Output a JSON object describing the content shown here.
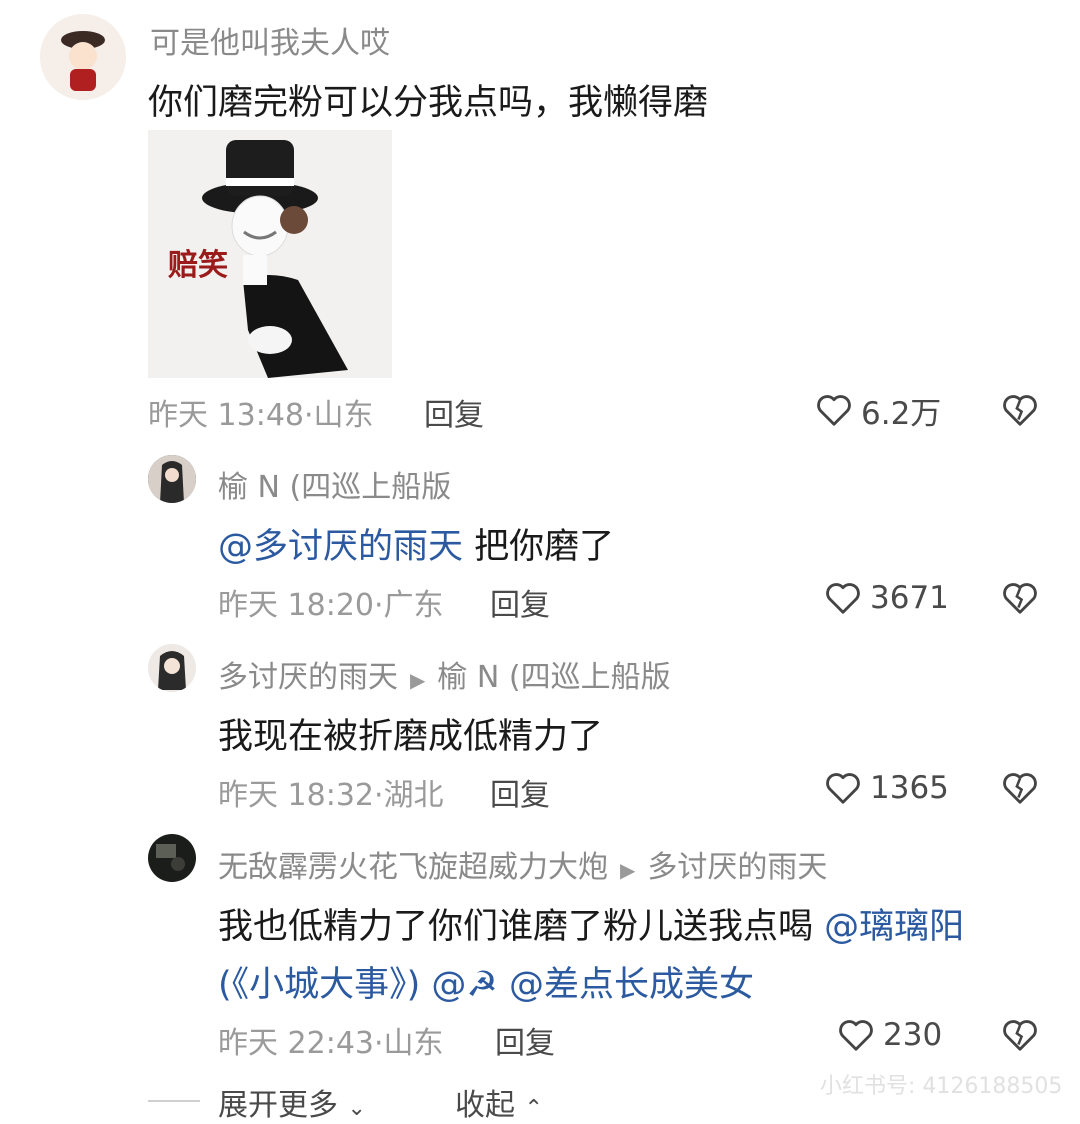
{
  "comments": [
    {
      "username": "可是他叫我夫人哎",
      "text": "你们磨完粉可以分我点吗，我懒得磨",
      "sticker_text": "赔笑",
      "time": "昨天 13:48",
      "location": "山东",
      "reply_label": "回复",
      "likes": "6.2万"
    }
  ],
  "replies": [
    {
      "username": "榆 N (四巡上船版",
      "mention": "@多讨厌的雨天",
      "text": " 把你磨了",
      "time": "昨天 18:20",
      "location": "广东",
      "reply_label": "回复",
      "likes": "3671"
    },
    {
      "username": "多讨厌的雨天",
      "reply_to": "榆 N (四巡上船版",
      "text": "我现在被折磨成低精力了",
      "time": "昨天 18:32",
      "location": "湖北",
      "reply_label": "回复",
      "likes": "1365"
    },
    {
      "username": "无敌霹雳火花飞旋超威力大炮",
      "reply_to": "多讨厌的雨天",
      "text_line1": "我也低精力了你们谁磨了粉儿送我点喝 ",
      "mention1": "@璃璃阳",
      "mention2_line2": "(《小城大事》) @☭ @差点长成美女",
      "time": "昨天 22:43",
      "location": "山东",
      "reply_label": "回复",
      "likes": "230"
    }
  ],
  "footer": {
    "expand_more": "展开更多",
    "collapse": "收起",
    "watermark": "小红书号: 4126188505"
  },
  "colors": {
    "mention": "#2c5aa0",
    "meta": "#9a9a9a",
    "name": "#8a8a8a"
  },
  "icons": [
    "heart-icon",
    "broken-heart-icon",
    "chevron-down-icon",
    "chevron-up-icon",
    "arrow-right-icon"
  ]
}
